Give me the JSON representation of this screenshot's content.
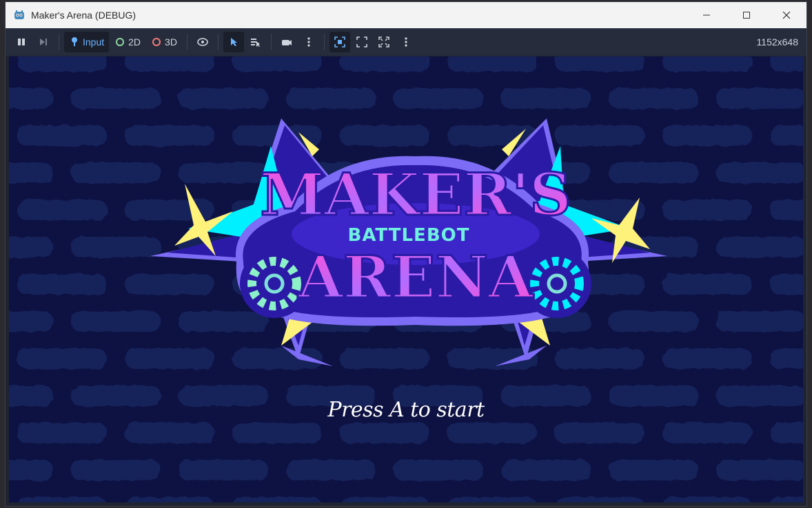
{
  "window": {
    "title": "Maker's Arena (DEBUG)",
    "icon": "godot-icon"
  },
  "toolbar": {
    "pause": "pause-icon",
    "step": "next-frame-icon",
    "input_label": "Input",
    "mode_2d_label": "2D",
    "mode_3d_label": "3D",
    "resolution": "1152x648",
    "accent": "#6cb4ff"
  },
  "game": {
    "logo": {
      "line1": "MAKER'S",
      "line2": "BATTLEBOT",
      "line3": "ARENA"
    },
    "prompt": "Press A to start",
    "colors": {
      "background": "#0d1242",
      "blob": "#16205a",
      "logo_bg": "#2b1aa6",
      "logo_outline": "#7d6cf5",
      "pink": "#ff4fd8",
      "cyan": "#00f0ff",
      "yellow": "#fff27a",
      "purple": "#3c25c9"
    }
  }
}
